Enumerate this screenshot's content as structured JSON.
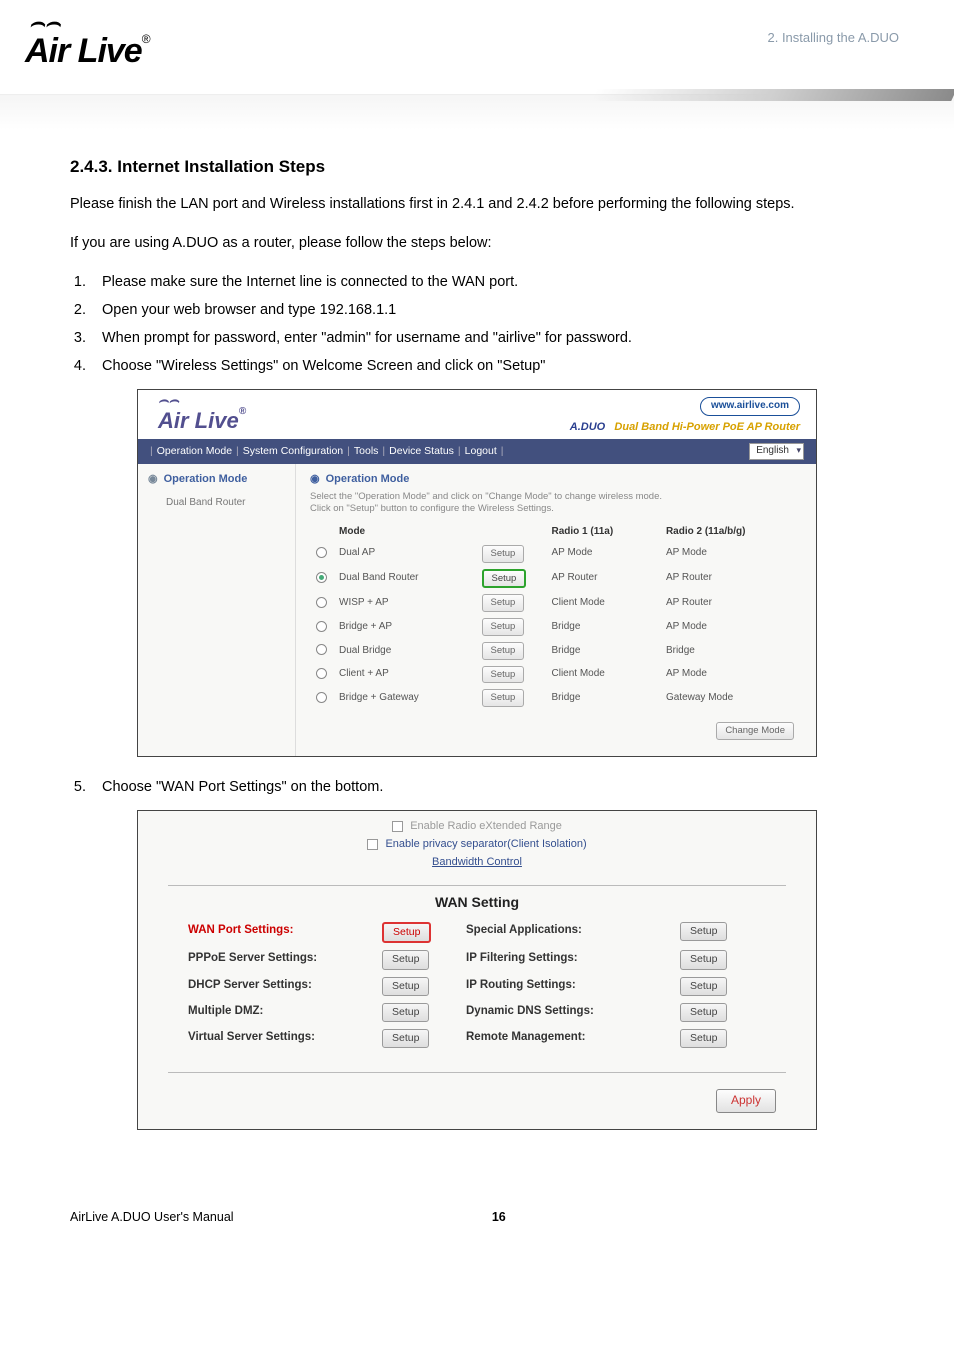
{
  "page": {
    "chapter_label": "2. Installing the A.DUO",
    "logo_text": "Air Live",
    "logo_reg": "®",
    "footer_left": "AirLive A.DUO User's Manual",
    "footer_page": "16"
  },
  "doc": {
    "section_heading": "2.4.3.  Internet Installation Steps",
    "para1": "Please finish the LAN port and Wireless installations first in 2.4.1 and 2.4.2 before performing the following steps.",
    "para2": "If you are using A.DUO as a router, please follow the steps below:",
    "steps": [
      "Please make sure the Internet line is connected to the WAN port.",
      "Open your web browser and type 192.168.1.1",
      "When prompt for password, enter \"admin\" for username and \"airlive\" for password.",
      "Choose \"Wireless Settings\" on Welcome Screen and click on \"Setup\""
    ],
    "step5": "Choose \"WAN Port Settings\" on the bottom."
  },
  "shot1": {
    "brand": "Air Live",
    "brand_reg": "®",
    "url_badge": "www.airlive.com",
    "product_id": "A.DUO",
    "product_tag": "Dual Band Hi-Power PoE AP Router",
    "nav": [
      "Operation Mode",
      "System Configuration",
      "Tools",
      "Device Status",
      "Logout"
    ],
    "lang": "English",
    "side_header": "Operation Mode",
    "side_item": "Dual Band Router",
    "main_title": "Operation Mode",
    "desc_line1": "Select the \"Operation Mode\" and click on \"Change Mode\" to change wireless mode.",
    "desc_line2": "Click on \"Setup\" button to configure the Wireless Settings.",
    "th_mode": "Mode",
    "th_r1": "Radio 1 (11a)",
    "th_r2": "Radio 2 (11a/b/g)",
    "rows": [
      {
        "sel": false,
        "mode": "Dual AP",
        "btn": "Setup",
        "r1": "AP Mode",
        "r2": "AP Mode"
      },
      {
        "sel": true,
        "mode": "Dual Band Router",
        "btn": "Setup",
        "r1": "AP Router",
        "r2": "AP Router"
      },
      {
        "sel": false,
        "mode": "WISP + AP",
        "btn": "Setup",
        "r1": "Client Mode",
        "r2": "AP Router"
      },
      {
        "sel": false,
        "mode": "Bridge + AP",
        "btn": "Setup",
        "r1": "Bridge",
        "r2": "AP Mode"
      },
      {
        "sel": false,
        "mode": "Dual Bridge",
        "btn": "Setup",
        "r1": "Bridge",
        "r2": "Bridge"
      },
      {
        "sel": false,
        "mode": "Client + AP",
        "btn": "Setup",
        "r1": "Client Mode",
        "r2": "AP Mode"
      },
      {
        "sel": false,
        "mode": "Bridge + Gateway",
        "btn": "Setup",
        "r1": "Bridge",
        "r2": "Gateway Mode"
      }
    ],
    "change_mode": "Change Mode"
  },
  "shot2": {
    "chk1": "Enable Radio eXtended Range",
    "chk2": "Enable privacy separator(Client Isolation)",
    "bw": "Bandwidth Control",
    "title": "WAN Setting",
    "left": [
      {
        "label": "WAN Port Settings:",
        "red": true
      },
      {
        "label": "PPPoE Server Settings:",
        "red": false
      },
      {
        "label": "DHCP Server Settings:",
        "red": false
      },
      {
        "label": "Multiple DMZ:",
        "red": false
      },
      {
        "label": "Virtual Server Settings:",
        "red": false
      }
    ],
    "right": [
      {
        "label": "Special Applications:"
      },
      {
        "label": "IP Filtering Settings:"
      },
      {
        "label": "IP Routing Settings:"
      },
      {
        "label": "Dynamic DNS Settings:"
      },
      {
        "label": "Remote Management:"
      }
    ],
    "setup": "Setup",
    "apply": "Apply"
  },
  "icons": {
    "bullet": "◉"
  }
}
